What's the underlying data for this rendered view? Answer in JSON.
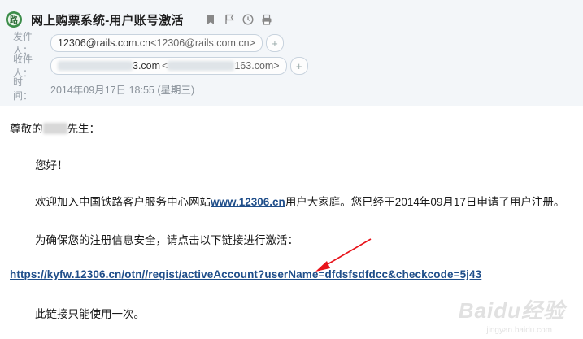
{
  "email": {
    "subject": "网上购票系统-用户账号激活",
    "brand_icon_text": "路",
    "sender": {
      "label": "发件人：",
      "name": "12306@rails.com.cn",
      "address": "<12306@rails.com.cn>"
    },
    "recipient": {
      "label": "收件人：",
      "name_visible_tail": "3.com",
      "address_visible_tail": "163.com>"
    },
    "time": {
      "label": "时　间：",
      "value": "2014年09月17日 18:55 (星期三)"
    },
    "action_icons": [
      "bookmark-icon",
      "flag-icon",
      "clock-icon",
      "print-icon"
    ]
  },
  "body": {
    "salutation_prefix": "尊敬的",
    "salutation_suffix": "先生：",
    "greeting": "您好！",
    "welcome_prefix": "欢迎加入中国铁路客户服务中心网站",
    "welcome_link": "www.12306.cn",
    "welcome_suffix": "用户大家庭。您已经于2014年09月17日申请了用户注册。",
    "security_notice": "为确保您的注册信息安全，请点击以下链接进行激活：",
    "activation_link": "https://kyfw.12306.cn/otn//regist/activeAccount?userName=dfdsfsdfdcc&checkcode=5j43",
    "once_notice": "此链接只能使用一次。"
  },
  "watermark": {
    "text": "Baidu经验",
    "subtext": "jingyan.baidu.com"
  },
  "colors": {
    "header_bg": "#f3f6f9",
    "link": "#1f4e8a",
    "arrow": "#e8141b",
    "chip_border": "#c8d3de"
  }
}
